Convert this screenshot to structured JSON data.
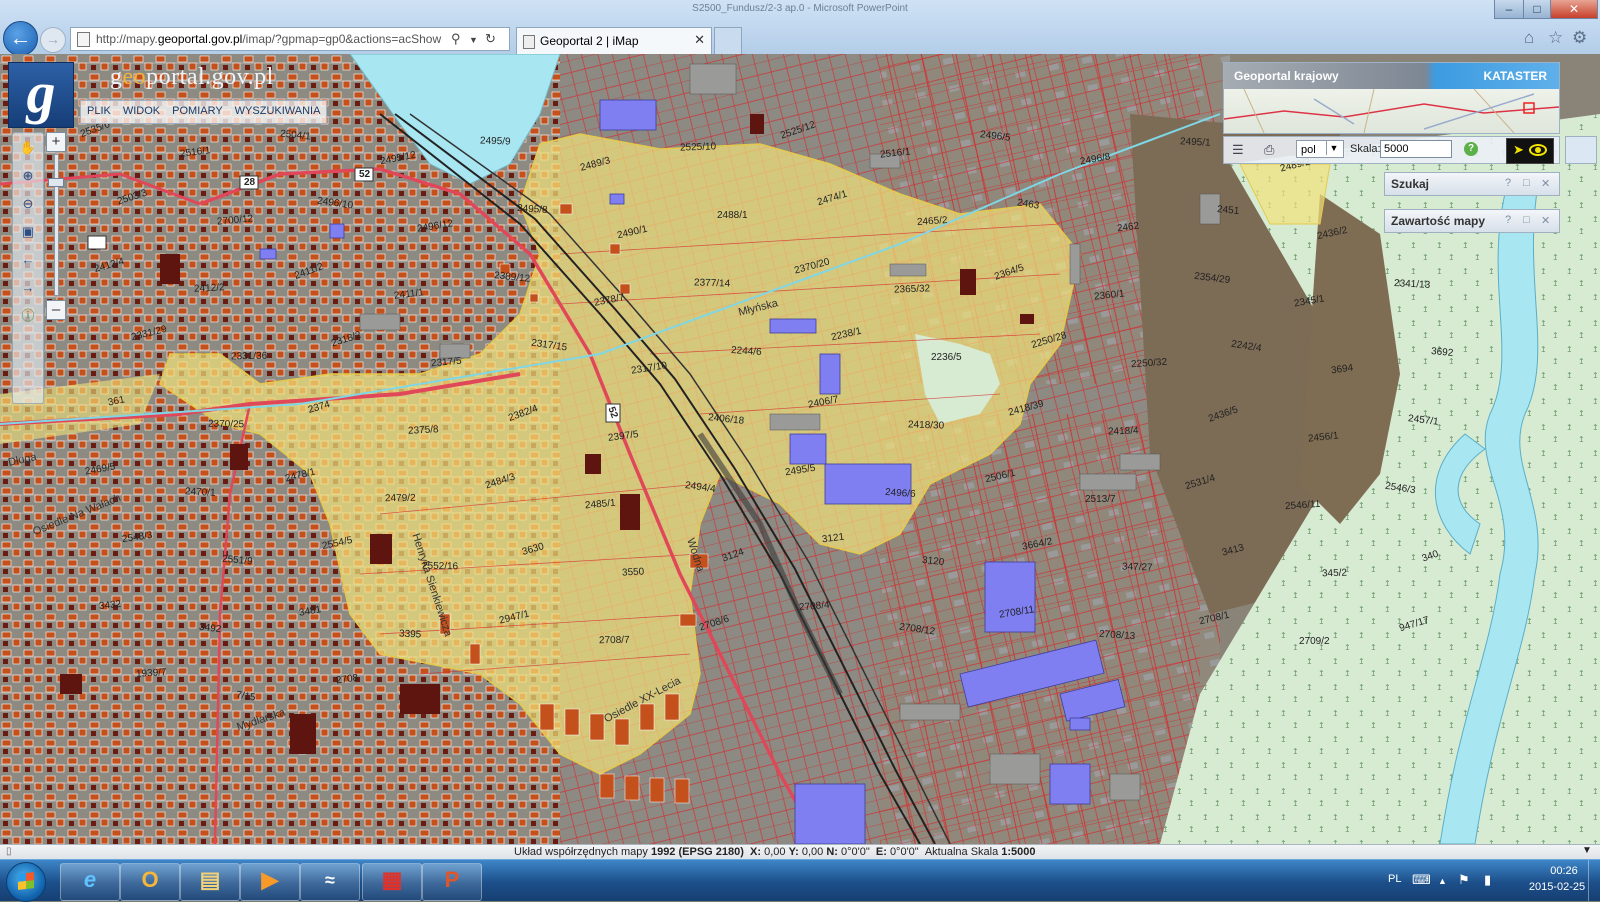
{
  "window": {
    "title": "S2500_Fundusz/2-3 ap.0 - Microsoft PowerPoint",
    "minimize_icon": "minimize-icon",
    "maximize_icon": "maximize-icon",
    "close_icon": "close-icon"
  },
  "browser": {
    "url_host_prefix": "http://mapy.",
    "url_host_bold": "geoportal.gov.pl",
    "url_path": "/imap/?gpmap=gp0&actions=acShow",
    "tab_title": "Geoportal 2 | iMap",
    "icons": [
      "back-icon",
      "forward-icon",
      "search-icon",
      "refresh-icon",
      "home-icon",
      "favorites-star-icon",
      "settings-gear-icon"
    ]
  },
  "app": {
    "logo_letter": "g",
    "site_name_a": "g",
    "site_name_hi": "eo",
    "site_name_b": "portal.gov.pl",
    "menu": [
      "PLIK",
      "WIDOK",
      "POMIARY",
      "WYSZUKIWANIA"
    ]
  },
  "panels": {
    "overview_title": "Geoportal krajowy",
    "overview_mode": "KATASTER",
    "lang": "pol",
    "scale_label": "Skala:",
    "scale_value": "5000",
    "help": "?",
    "search_panel": "Szukaj",
    "content_panel": "Zawartość mapy"
  },
  "map": {
    "accent_parcels": "#d8282c",
    "highlight": "#f2e27a",
    "buildings_residential": "#c4501b",
    "buildings_public": "#7f7ff2",
    "river": "#a8e6f2",
    "forest": "#d7ead2",
    "road_numbers": [
      "28",
      "52",
      "52"
    ],
    "streets": [
      "Młyńska",
      "Osiedle XX-Lecia",
      "Osiedle Na Wałach",
      "Henryka Sienkiewicza",
      "Wodna",
      "Długa",
      "Mydlarska"
    ],
    "parcel_labels": [
      "2535/6",
      "2516/1",
      "2504/1",
      "2495/12",
      "2495/9",
      "2489/3",
      "2525/10",
      "2525/12",
      "2516/1",
      "2496/5",
      "2496/8",
      "2495/1",
      "2489/2",
      "2700/6",
      "2503/3",
      "2700/12",
      "2496/10",
      "2496/12",
      "2495/8",
      "2490/1",
      "2488/1",
      "2474/1",
      "2465/2",
      "2463",
      "2462",
      "2451",
      "2436/2",
      "2435/1",
      "2412/4",
      "2412/2",
      "2411/2",
      "2411/1",
      "2389/12",
      "2378/7",
      "2377/14",
      "2370/20",
      "2365/32",
      "2364/5",
      "2360/1",
      "2354/29",
      "2345/1",
      "2341/13",
      "2331/29",
      "2331/36",
      "2318/2",
      "2317/5",
      "2317/15",
      "2317/10",
      "2244/6",
      "2238/1",
      "2236/5",
      "2250/28",
      "2250/32",
      "2242/4",
      "3694",
      "3692",
      "361",
      "2370/25",
      "2374",
      "2375/8",
      "2382/4",
      "2397/5",
      "2406/18",
      "2406/7",
      "2418/30",
      "2418/39",
      "2418/4",
      "2436/5",
      "2456/1",
      "2457/1",
      "2469/5",
      "2470/1",
      "2478/1",
      "2479/2",
      "2484/3",
      "2485/1",
      "2494/4",
      "2495/5",
      "2496/6",
      "2506/1",
      "2513/7",
      "2531/4",
      "2546/11",
      "2546/3",
      "2548/3",
      "2551/9",
      "2554/5",
      "2552/16",
      "3630",
      "3550",
      "3124",
      "3121",
      "3120",
      "3664/2",
      "347/27",
      "3413",
      "345/2",
      "340",
      "3432",
      "3492",
      "3481",
      "3395",
      "2947/1",
      "2708/7",
      "2708/6",
      "2708/4",
      "2708/12",
      "2708/11",
      "2708/13",
      "2708/1",
      "2709/2",
      "947/17",
      "1939/7",
      "7/15",
      "2708"
    ]
  },
  "status": {
    "prefix": "Układ współrzędnych mapy ",
    "crs": "1992 (EPSG 2180)",
    "x_label": "X:",
    "x_value": "0,00",
    "y_label": "Y:",
    "y_value": "0,00",
    "n_label": "N:",
    "n_value": "0°0'0\"",
    "e_label": "E:",
    "e_value": "0°0'0\"",
    "scale_prefix": "Aktualna Skala",
    "scale_value": "1:5000"
  },
  "taskbar": {
    "apps": [
      "internet-explorer",
      "outlook",
      "file-explorer",
      "media-player",
      "wifi",
      "network-app",
      "powerpoint"
    ],
    "lang": "PL",
    "time": "00:26",
    "date": "2015-02-25"
  }
}
